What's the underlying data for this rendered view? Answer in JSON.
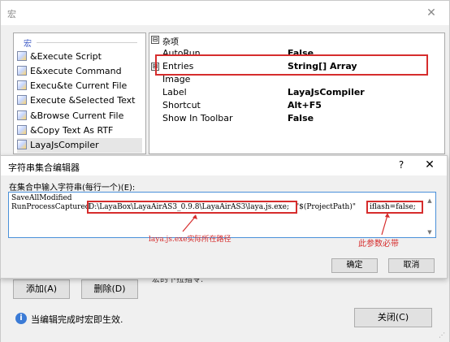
{
  "macro_window": {
    "title": "宏",
    "close_glyph": "✕",
    "list": {
      "header": "宏",
      "items": [
        {
          "label": "&Execute Script"
        },
        {
          "label": "E&xecute Command"
        },
        {
          "label": "Execu&te Current File"
        },
        {
          "label": "Execute &Selected Text"
        },
        {
          "label": "&Browse Current File"
        },
        {
          "label": "&Copy Text As RTF"
        },
        {
          "label": "LayaJsCompiler"
        }
      ]
    },
    "property_grid": {
      "section": "杂项",
      "section_toggle": "⊟",
      "rows": [
        {
          "key": "AutoRun",
          "value": "False"
        },
        {
          "key": "Entries",
          "value": "String[] Array",
          "expander": "⊞"
        },
        {
          "key": "Image",
          "value": ""
        },
        {
          "key": "Label",
          "value": "LayaJsCompiler"
        },
        {
          "key": "Shortcut",
          "value": "Alt+F5"
        },
        {
          "key": "Show In Toolbar",
          "value": "False"
        }
      ]
    },
    "description_text": "宏的下拉指令.",
    "add_button": "添加(A)",
    "delete_button": "删除(D)",
    "info_icon": "i",
    "info_text": "当编辑完成时宏即生效.",
    "close_button": "关闭(C)",
    "resize_grip": "⋰"
  },
  "string_dialog": {
    "title": "字符串集合编辑器",
    "help_glyph": "?",
    "close_glyph": "✕",
    "instruction": "在集合中输入字符串(每行一个)(E):",
    "editor_lines": {
      "line1": "SaveAllModified",
      "line2_prefix": "RunProcessCaptured",
      "line2_path": "D:\\LayaBox\\LayaAirAS3_0.9.8\\LayaAirAS3\\laya.js.exe;",
      "line2_arg": "\"$(ProjectPath)\"",
      "line2_flag": "iflash=false;"
    },
    "scroll_up": "▲",
    "scroll_down": "▼",
    "annotation_path": "laya.js.exe实际所在路径",
    "annotation_flag": "此参数必带",
    "ok_button": "确定",
    "cancel_button": "取消"
  },
  "colors": {
    "highlight": "#d62d2d",
    "editor_border": "#4a90d9",
    "link_blue": "#3a57c5"
  }
}
